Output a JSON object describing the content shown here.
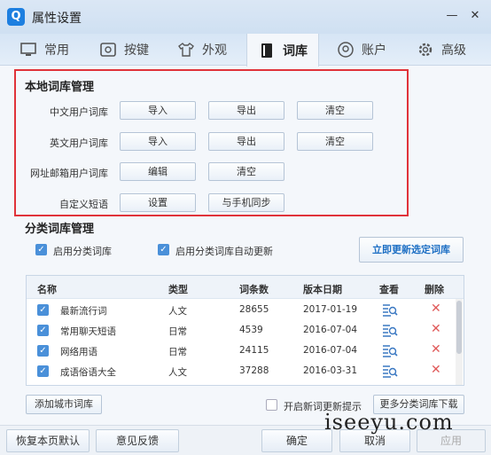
{
  "window": {
    "title": "属性设置",
    "logo": "Q",
    "minimize": "—",
    "close": "✕"
  },
  "tabs": [
    {
      "label": "常用",
      "icon": "monitor-icon"
    },
    {
      "label": "按键",
      "icon": "keyboard-icon"
    },
    {
      "label": "外观",
      "icon": "shirt-icon"
    },
    {
      "label": "词库",
      "icon": "book-icon",
      "active": true
    },
    {
      "label": "账户",
      "icon": "account-icon"
    },
    {
      "label": "高级",
      "icon": "gear-icon"
    }
  ],
  "local": {
    "title": "本地词库管理",
    "rows": [
      {
        "label": "中文用户词库",
        "buttons": [
          "导入",
          "导出",
          "清空"
        ]
      },
      {
        "label": "英文用户词库",
        "buttons": [
          "导入",
          "导出",
          "清空"
        ]
      },
      {
        "label": "网址邮箱用户词库",
        "buttons": [
          "编辑",
          "清空"
        ]
      },
      {
        "label": "自定义短语",
        "buttons": [
          "设置",
          "与手机同步"
        ]
      }
    ]
  },
  "category": {
    "title": "分类词库管理",
    "enable_label": "启用分类词库",
    "auto_update_label": "启用分类词库自动更新",
    "update_now": "立即更新选定词库",
    "columns": [
      "名称",
      "类型",
      "词条数",
      "版本日期",
      "查看",
      "删除"
    ],
    "rows": [
      {
        "name": "最新流行词",
        "type": "人文",
        "count": "28655",
        "date": "2017-01-19"
      },
      {
        "name": "常用聊天短语",
        "type": "日常",
        "count": "4539",
        "date": "2016-07-04"
      },
      {
        "name": "网络用语",
        "type": "日常",
        "count": "24115",
        "date": "2016-07-04"
      },
      {
        "name": "成语俗语大全",
        "type": "人文",
        "count": "37288",
        "date": "2016-03-31"
      }
    ],
    "add_city": "添加城市词库",
    "new_word_tip": "开启新词更新提示",
    "more_download": "更多分类词库下载"
  },
  "footer": {
    "restore": "恢复本页默认",
    "feedback": "意见反馈",
    "ok": "确定",
    "cancel": "取消",
    "apply": "应用"
  },
  "watermark": "iseeyu.com",
  "colors": {
    "accent": "#4a90d9",
    "highlight_box": "#e0333a",
    "delete": "#e05a5a"
  }
}
